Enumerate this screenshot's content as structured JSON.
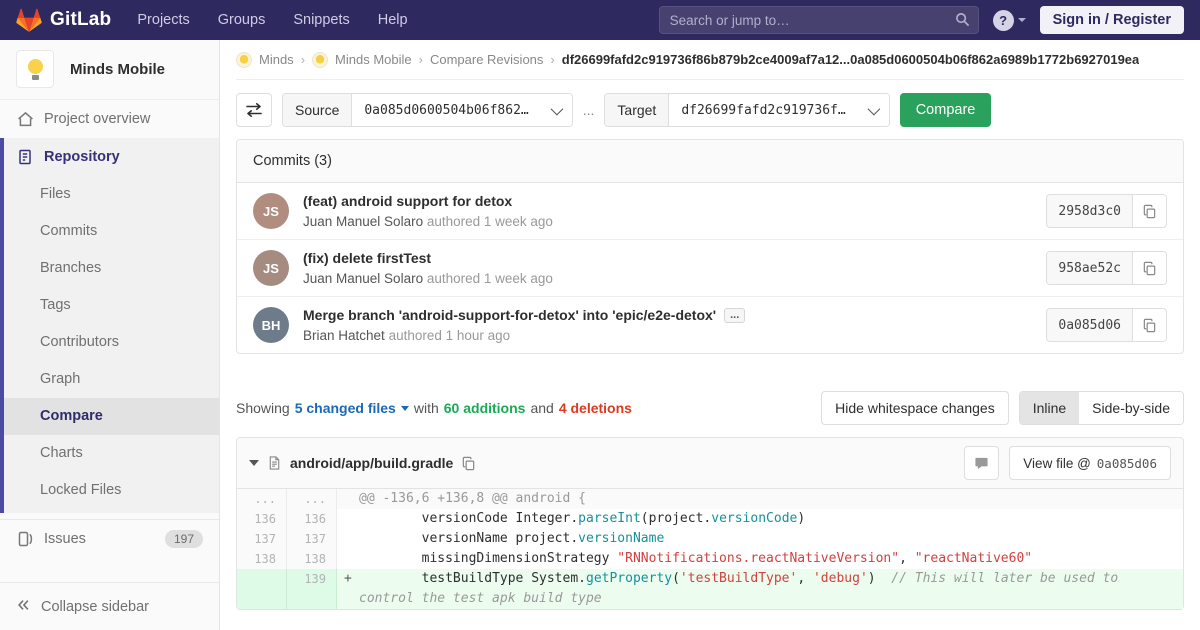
{
  "navbar": {
    "logo_text": "GitLab",
    "menu": [
      "Projects",
      "Groups",
      "Snippets",
      "Help"
    ],
    "search_placeholder": "Search or jump to…",
    "signin_label": "Sign in / Register"
  },
  "sidebar": {
    "project_title": "Minds Mobile",
    "overview_label": "Project overview",
    "repository_label": "Repository",
    "repo_items": [
      "Files",
      "Commits",
      "Branches",
      "Tags",
      "Contributors",
      "Graph",
      "Compare",
      "Charts",
      "Locked Files"
    ],
    "active_repo_item": "Compare",
    "issues_label": "Issues",
    "issues_count": "197",
    "collapse_label": "Collapse sidebar"
  },
  "breadcrumb": {
    "items": [
      "Minds",
      "Minds Mobile",
      "Compare Revisions"
    ],
    "separator": "›",
    "current": "df26699fafd2c919736f86b879b2ce4009af7a12...0a085d0600504b06f862a6989b1772b6927019ea"
  },
  "compare_form": {
    "source_label": "Source",
    "source_value": "0a085d0600504b06f862…",
    "separator": "...",
    "target_label": "Target",
    "target_value": "df26699fafd2c919736f…",
    "compare_button": "Compare"
  },
  "commits": {
    "header": "Commits (3)",
    "rows": [
      {
        "initials": "JS",
        "avatar_color": "#b08d7e",
        "title": "(feat) android support for detox",
        "author": "Juan Manuel Solaro",
        "meta": "authored 1 week ago",
        "sha": "2958d3c0"
      },
      {
        "initials": "JS",
        "avatar_color": "#a68b80",
        "title": "(fix) delete firstTest",
        "author": "Juan Manuel Solaro",
        "meta": "authored 1 week ago",
        "sha": "958ae52c"
      },
      {
        "initials": "BH",
        "avatar_color": "#6e7b8a",
        "title": "Merge branch 'android-support-for-detox' into 'epic/e2e-detox'",
        "author": "Brian Hatchet",
        "meta": "authored 1 hour ago",
        "sha": "0a085d06",
        "expander": "..."
      }
    ]
  },
  "summary": {
    "showing": "Showing",
    "changed_files": "5 changed files",
    "with": "with",
    "additions": "60 additions",
    "and": "and",
    "deletions": "4 deletions",
    "hide_whitespace": "Hide whitespace changes",
    "inline": "Inline",
    "side_by_side": "Side-by-side"
  },
  "diff": {
    "filename": "android/app/build.gradle",
    "view_file_label": "View file @",
    "view_file_sha": "0a085d06",
    "lines": [
      {
        "type": "hunk",
        "old": "...",
        "new": "...",
        "tokens": [
          {
            "t": "@@ -136,6 +136,8 @@ android {",
            "c": "hunk"
          }
        ]
      },
      {
        "type": "ctx",
        "old": "136",
        "new": "136",
        "tokens": [
          {
            "t": "        versionCode Integer.",
            "c": "p"
          },
          {
            "t": "parseInt",
            "c": "fn"
          },
          {
            "t": "(project.",
            "c": "p"
          },
          {
            "t": "versionCode",
            "c": "fn"
          },
          {
            "t": ")",
            "c": "p"
          }
        ]
      },
      {
        "type": "ctx",
        "old": "137",
        "new": "137",
        "tokens": [
          {
            "t": "        versionName project.",
            "c": "p"
          },
          {
            "t": "versionName",
            "c": "fn"
          }
        ]
      },
      {
        "type": "ctx",
        "old": "138",
        "new": "138",
        "tokens": [
          {
            "t": "        missingDimensionStrategy ",
            "c": "p"
          },
          {
            "t": "\"RNNotifications.reactNativeVersion\"",
            "c": "str"
          },
          {
            "t": ", ",
            "c": "p"
          },
          {
            "t": "\"reactNative60\"",
            "c": "str"
          }
        ]
      },
      {
        "type": "add",
        "old": "",
        "new": "139",
        "sign": "+",
        "tokens": [
          {
            "t": "        testBuildType System.",
            "c": "p"
          },
          {
            "t": "getProperty",
            "c": "fn"
          },
          {
            "t": "(",
            "c": "p"
          },
          {
            "t": "'testBuildType'",
            "c": "str"
          },
          {
            "t": ", ",
            "c": "p"
          },
          {
            "t": "'debug'",
            "c": "str"
          },
          {
            "t": ")",
            "c": "p"
          },
          {
            "t": "  ",
            "c": "p"
          },
          {
            "t": "// This will later be used to control the test apk build type",
            "c": "com"
          }
        ]
      }
    ]
  },
  "colors": {
    "navbar_bg": "#2e2a5f",
    "accent_indigo": "#4b4ba3",
    "link_blue": "#1b69b6",
    "button_green": "#2aa15c",
    "addition_green": "#1aaa55",
    "deletion_red": "#db3b21"
  }
}
